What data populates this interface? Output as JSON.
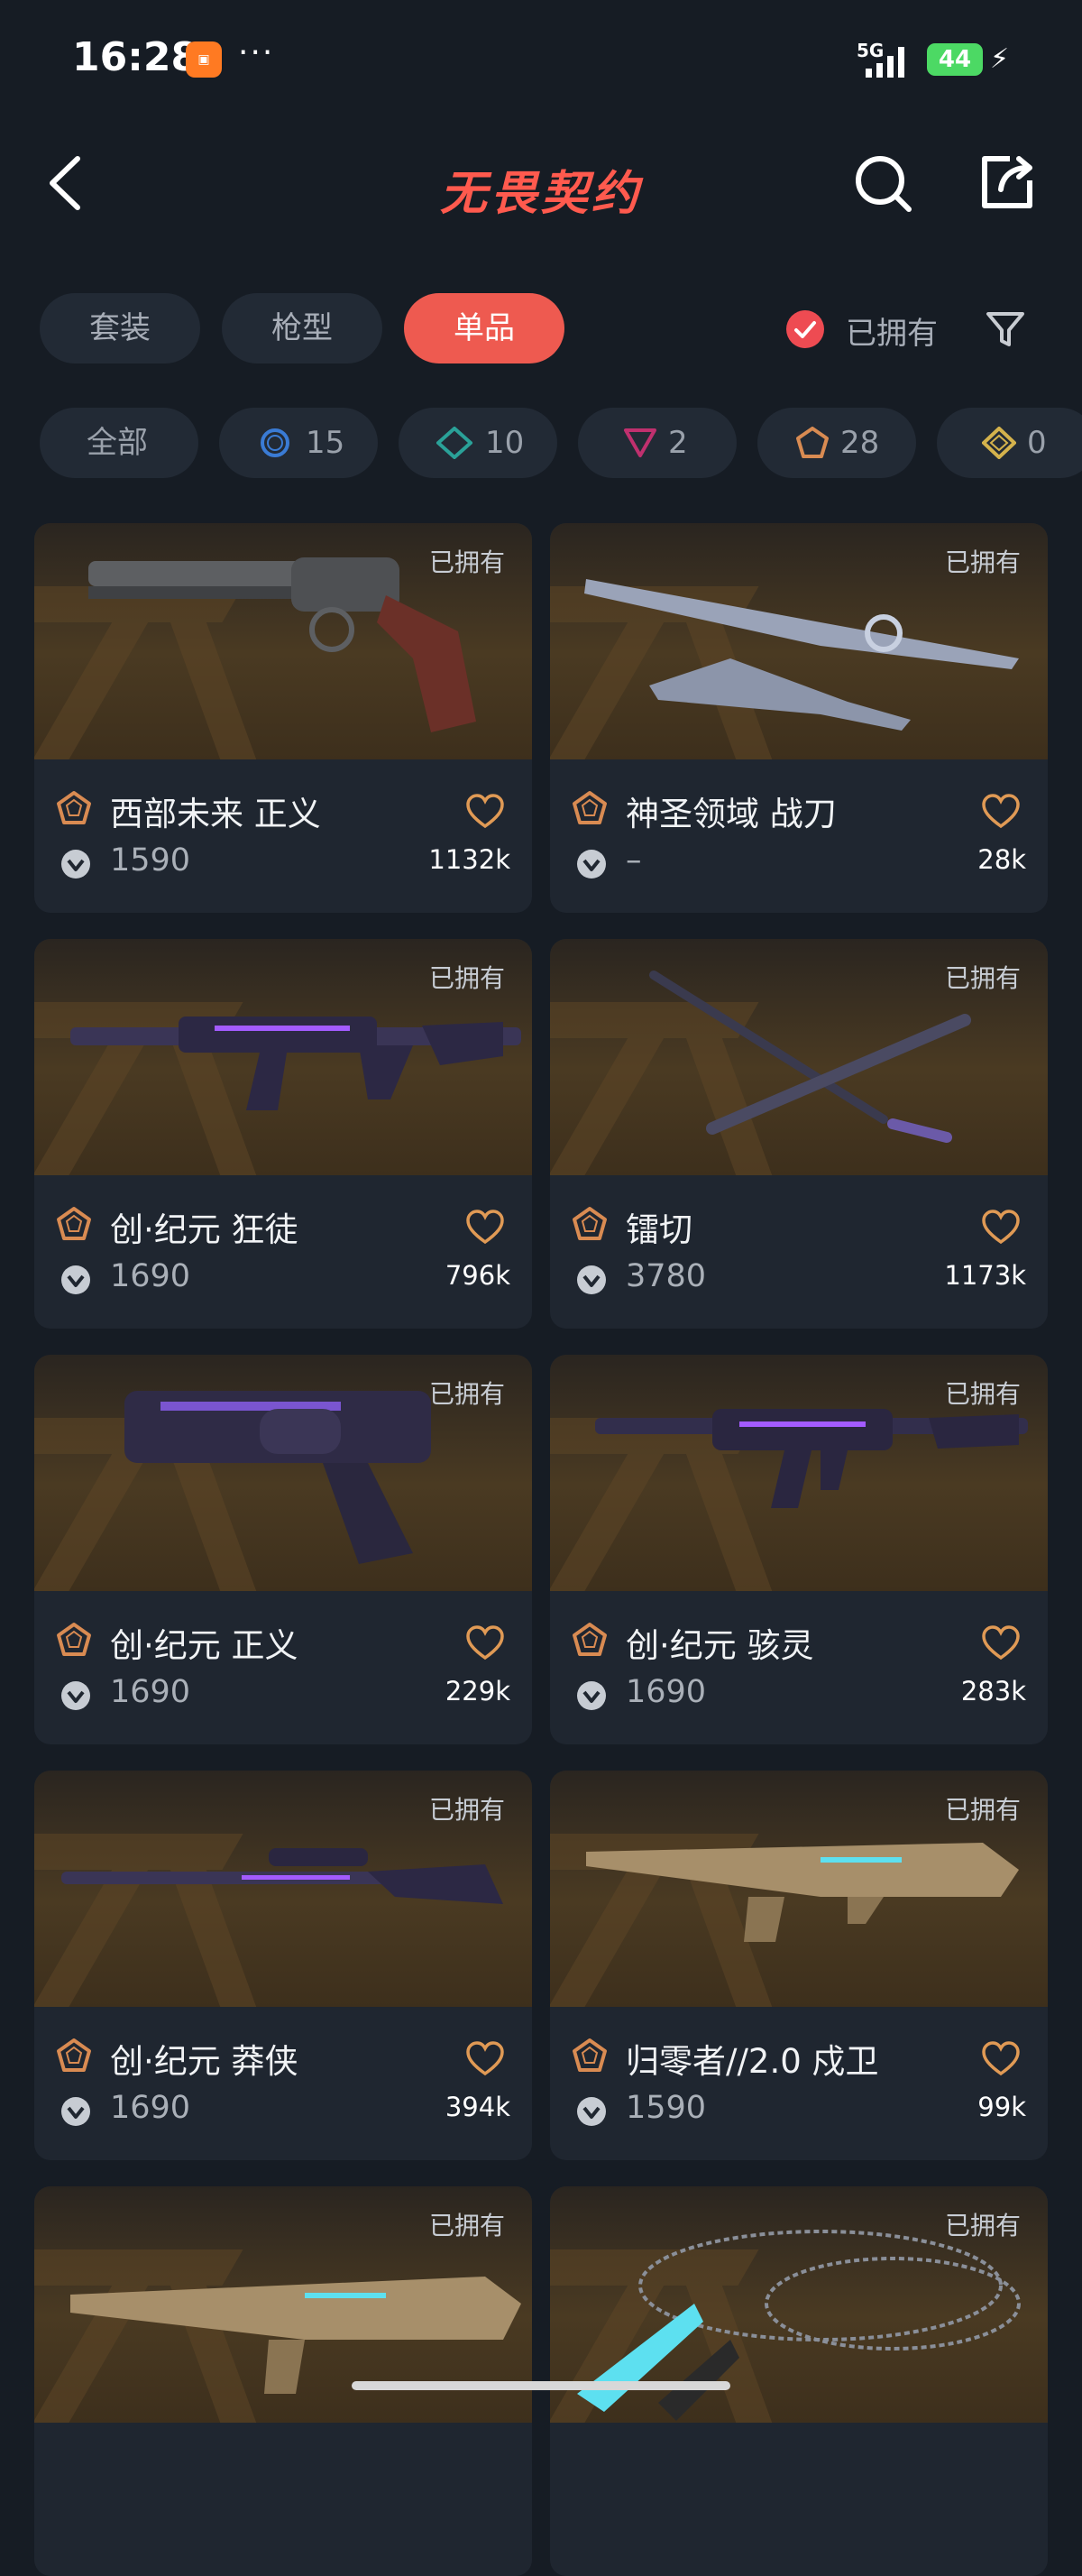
{
  "status_bar": {
    "time": "16:28",
    "network": "5G",
    "battery": "44"
  },
  "header": {
    "title": "无畏契约"
  },
  "tabs": [
    {
      "label": "套装",
      "active": false
    },
    {
      "label": "枪型",
      "active": false
    },
    {
      "label": "单品",
      "active": true
    }
  ],
  "owned_filter": {
    "label": "已拥有",
    "checked": true
  },
  "tier_chips": [
    {
      "label": "全部"
    },
    {
      "count": "15",
      "tier": "select",
      "color": "#3a7bd5"
    },
    {
      "count": "10",
      "tier": "deluxe",
      "color": "#2aa198"
    },
    {
      "count": "2",
      "tier": "premium",
      "color": "#c0306e"
    },
    {
      "count": "28",
      "tier": "exclusive",
      "color": "#d98b52"
    },
    {
      "count": "0",
      "tier": "ultra",
      "color": "#d4b24c"
    }
  ],
  "items": [
    {
      "name": "西部未来 正义",
      "price": "1590",
      "likes": "1132k",
      "owned": "已拥有"
    },
    {
      "name": "神圣领域 战刀",
      "price": "–",
      "likes": "28k",
      "owned": "已拥有"
    },
    {
      "name": "创·纪元 狂徒",
      "price": "1690",
      "likes": "796k",
      "owned": "已拥有"
    },
    {
      "name": "镭切",
      "price": "3780",
      "likes": "1173k",
      "owned": "已拥有"
    },
    {
      "name": "创·纪元 正义",
      "price": "1690",
      "likes": "229k",
      "owned": "已拥有"
    },
    {
      "name": "创·纪元 骇灵",
      "price": "1690",
      "likes": "283k",
      "owned": "已拥有"
    },
    {
      "name": "创·纪元 莽侠",
      "price": "1690",
      "likes": "394k",
      "owned": "已拥有"
    },
    {
      "name": "归零者//2.0 戍卫",
      "price": "1590",
      "likes": "99k",
      "owned": "已拥有"
    },
    {
      "owned": "已拥有"
    },
    {
      "owned": "已拥有"
    }
  ],
  "colors": {
    "accent": "#ee5a50",
    "title": "#ff5a4e",
    "tier_exclusive": "#d98b52",
    "heart": "#e09a55"
  }
}
